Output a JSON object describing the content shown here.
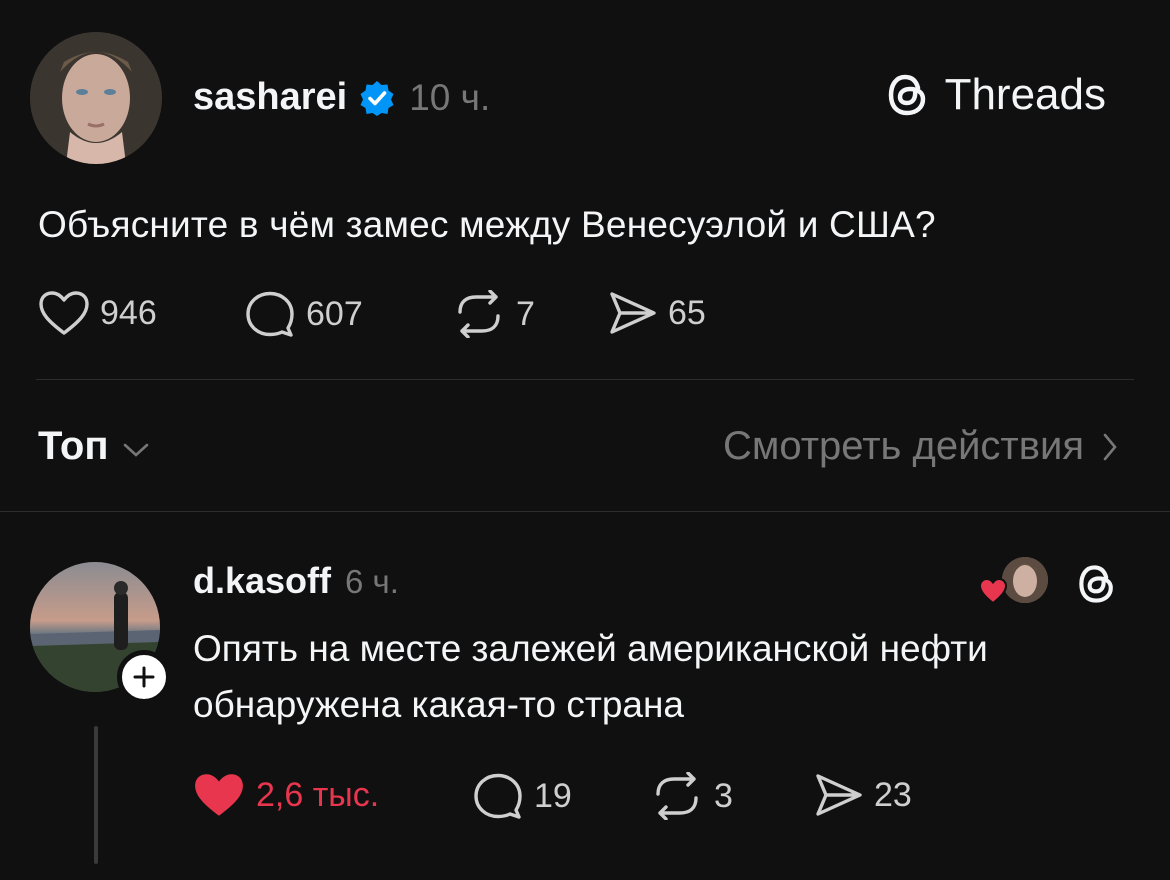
{
  "post": {
    "username": "sasharei",
    "verified": true,
    "time": "10 ч.",
    "text": "Объясните в чём замес между Венесуэлой и США?",
    "likes": "946",
    "replies": "607",
    "reposts": "7",
    "shares": "65"
  },
  "brand": {
    "label": "Threads",
    "icon": "threads-logo-icon"
  },
  "filter": {
    "sort_label": "Топ",
    "activity_label": "Смотреть действия"
  },
  "reply": {
    "username": "d.kasoff",
    "time": "6 ч.",
    "text_line1": "Опять на месте залежей американской нефти",
    "text_line2": "обнаружена какая-то страна",
    "likes": "2,6 тыс.",
    "liked": true,
    "replies": "19",
    "reposts": "3",
    "shares": "23"
  },
  "colors": {
    "background": "#101010",
    "text_primary": "#f3f5f7",
    "text_secondary": "#777777",
    "like_red": "#e8364f",
    "verified_blue": "#0095f6"
  }
}
